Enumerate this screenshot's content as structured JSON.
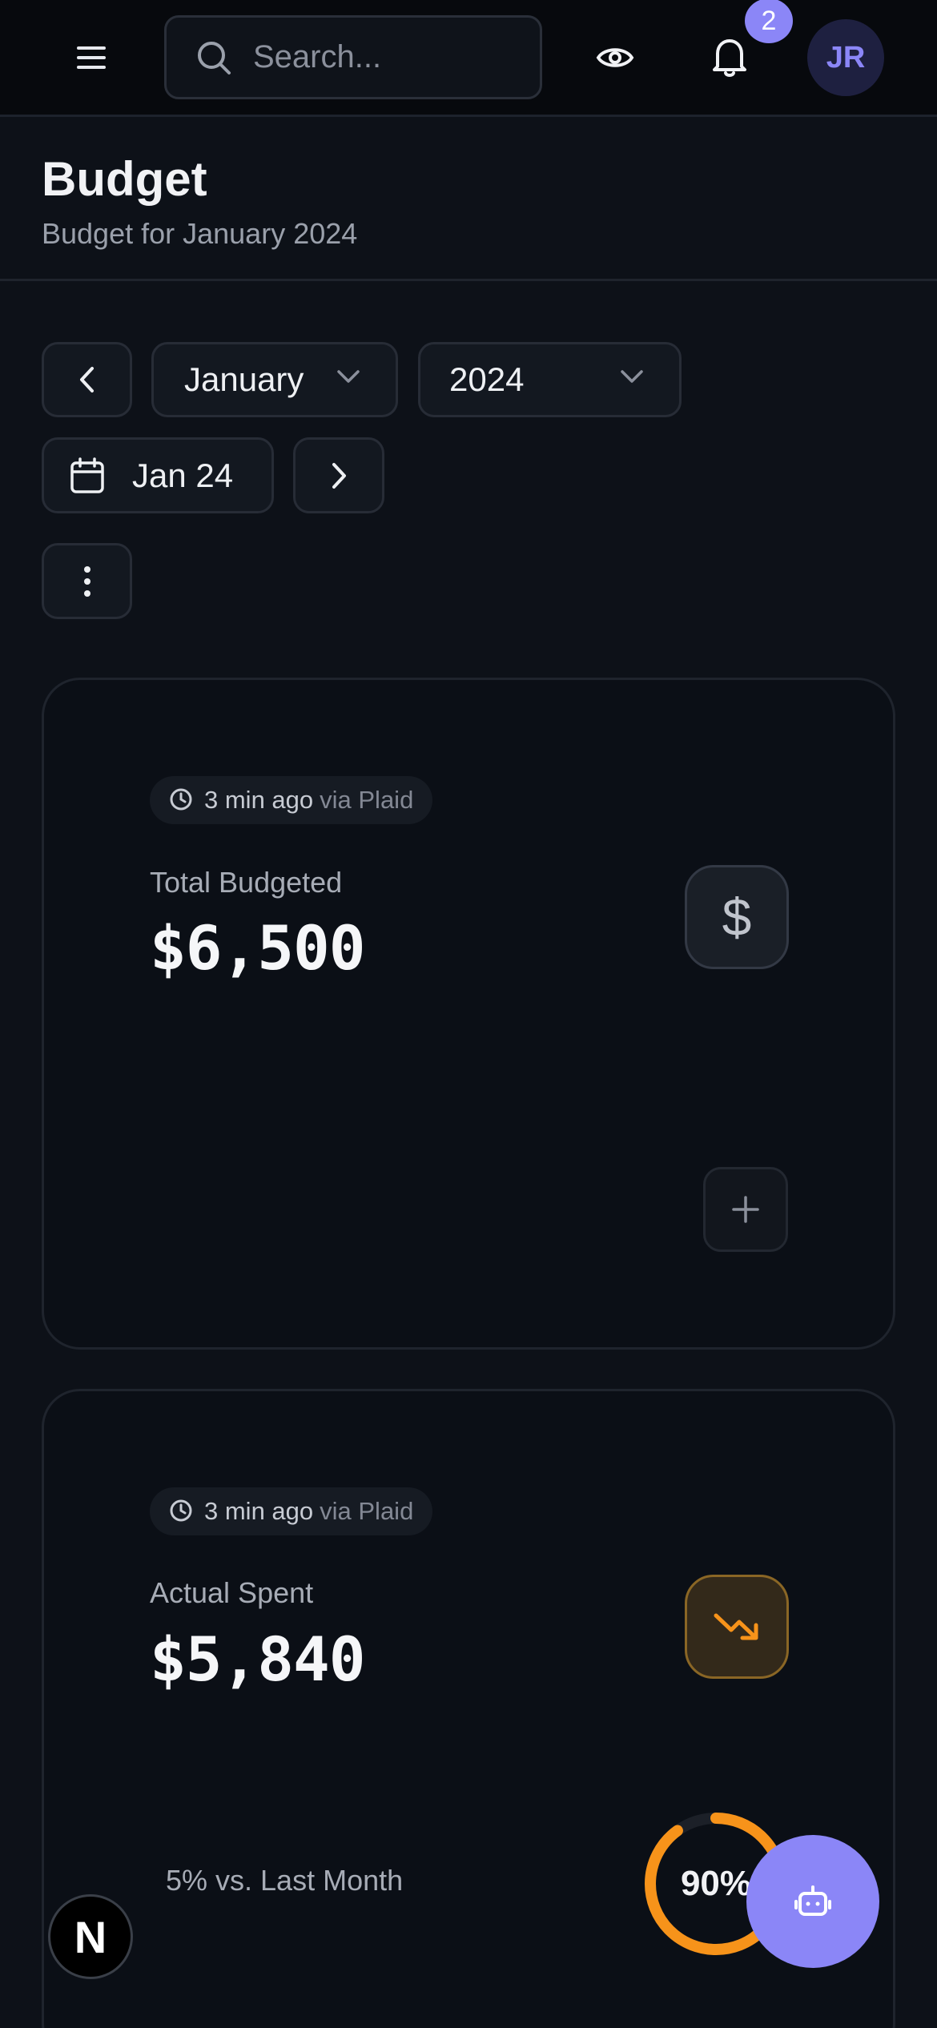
{
  "header": {
    "search_placeholder": "Search...",
    "notification_count": "2",
    "avatar_initials": "JR"
  },
  "page": {
    "title": "Budget",
    "subtitle": "Budget for January 2024"
  },
  "controls": {
    "month_selected": "January",
    "year_selected": "2024",
    "date_label": "Jan 24"
  },
  "cards": [
    {
      "sync_time": "3 min ago",
      "sync_source": "via Plaid",
      "label": "Total Budgeted",
      "value": "$6,500",
      "icon": "dollar-icon"
    },
    {
      "sync_time": "3 min ago",
      "sync_source": "via Plaid",
      "label": "Actual Spent",
      "value": "$5,840",
      "icon": "trending-down-icon",
      "comparison": "5% vs. Last Month",
      "progress_label": "90%",
      "progress_fraction": 0.9
    }
  ],
  "colors": {
    "background": "#0d1118",
    "accent": "#8b86f7",
    "warning": "#f7931a"
  },
  "floating": {
    "framework_badge": "N"
  }
}
